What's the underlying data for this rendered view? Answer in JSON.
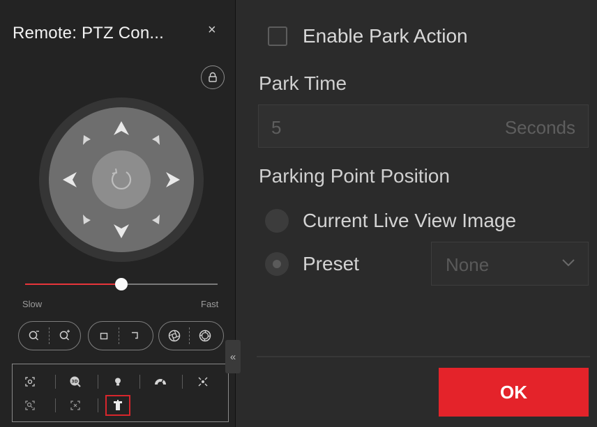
{
  "ptz_panel": {
    "title": "Remote: PTZ Con...",
    "close_glyph": "×",
    "icons": {
      "close": "close-icon",
      "lock": "lock-icon",
      "refresh": "refresh-icon",
      "arrows": "direction-arrow-icons"
    },
    "speed": {
      "min_label": "Slow",
      "max_label": "Fast",
      "value_fraction": 0.5
    },
    "controls": [
      {
        "group": "zoom",
        "buttons": [
          "zoom-out-icon",
          "zoom-in-icon"
        ]
      },
      {
        "group": "focus",
        "buttons": [
          "focus-near-icon",
          "focus-far-icon"
        ]
      },
      {
        "group": "iris",
        "buttons": [
          "iris-close-icon",
          "iris-open-icon"
        ]
      }
    ],
    "tools_row1": [
      "regional-focus-icon",
      "3d-zoom-icon",
      "light-icon",
      "wiper-icon",
      "auxiliary-focus-icon"
    ],
    "tools_row2": [
      "regional-exposure-icon",
      "lens-init-icon",
      "park-action-icon"
    ],
    "selected_tool": "park-action-icon",
    "collapse_glyph": "«"
  },
  "settings": {
    "enable_park_action": {
      "label": "Enable Park Action",
      "checked": false
    },
    "park_time": {
      "label": "Park Time",
      "value": "5",
      "unit": "Seconds"
    },
    "parking_point_position": {
      "label": "Parking Point Position",
      "options": [
        {
          "label": "Current Live View Image",
          "checked": false
        },
        {
          "label": "Preset",
          "checked": true
        }
      ],
      "preset_value": "None"
    },
    "ok_label": "OK"
  },
  "colors": {
    "accent": "#e4232a",
    "panel_bg": "#232323",
    "settings_bg": "#2b2b2b",
    "dpad_outer": "#3a3a3a",
    "dpad_ring": "#6e6e6e",
    "dpad_center": "#8a8a8a"
  }
}
